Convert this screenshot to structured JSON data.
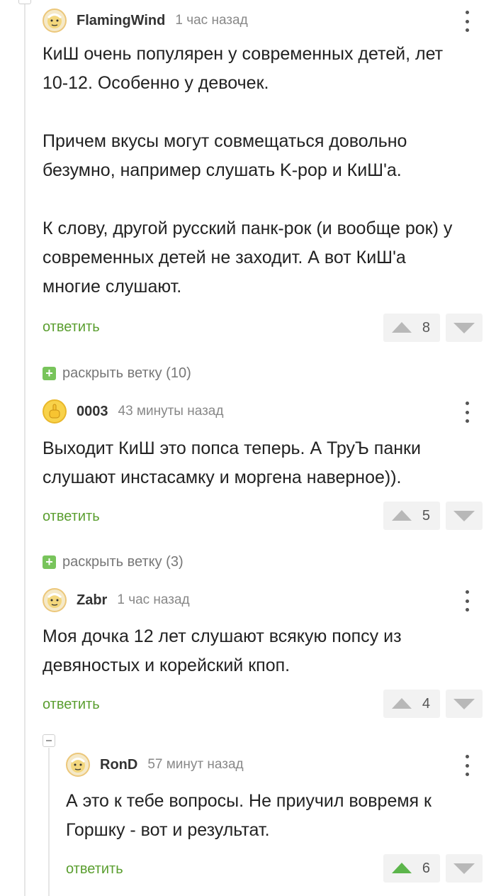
{
  "comments": [
    {
      "username": "FlamingWind",
      "time": "1 час назад",
      "text": "КиШ очень популярен у современных детей, лет 10-12. Особенно у девочек.\n\nПричем вкусы могут совмещаться довольно безумно, например слушать K-pop и КиШ'а.\n\nК слову, другой русский панк-рок (и вообще рок) у современных детей не заходит. А вот КиШ'а многие слушают.",
      "reply_label": "ответить",
      "votes": "8"
    },
    {
      "username": "0003",
      "time": "43 минуты назад",
      "text": "Выходит КиШ это попса теперь. А ТруЪ панки слушают инстасамку и моргена наверное)).",
      "reply_label": "ответить",
      "votes": "5"
    },
    {
      "username": "Zabr",
      "time": "1 час назад",
      "text": "Моя дочка 12 лет слушают всякую попсу из девяностых и корейский кпоп.",
      "reply_label": "ответить",
      "votes": "4"
    },
    {
      "username": "RonD",
      "time": "57 минут назад",
      "text": "А это к тебе вопросы. Не приучил вовремя к Горшку - вот и результат.",
      "reply_label": "ответить",
      "votes": "6"
    }
  ],
  "expanders": [
    {
      "plus": "+",
      "label": "раскрыть ветку (10)"
    },
    {
      "plus": "+",
      "label": "раскрыть ветку (3)"
    }
  ],
  "colors": {
    "accent": "#5a9e2f",
    "upvoted": "#5cb54b",
    "plus_badge": "#78c45b"
  },
  "icons": {
    "more": "more-vertical-icon",
    "upvote": "arrow-up-icon",
    "downvote": "arrow-down-icon",
    "expand": "plus-icon",
    "collapse": "minus-icon"
  }
}
